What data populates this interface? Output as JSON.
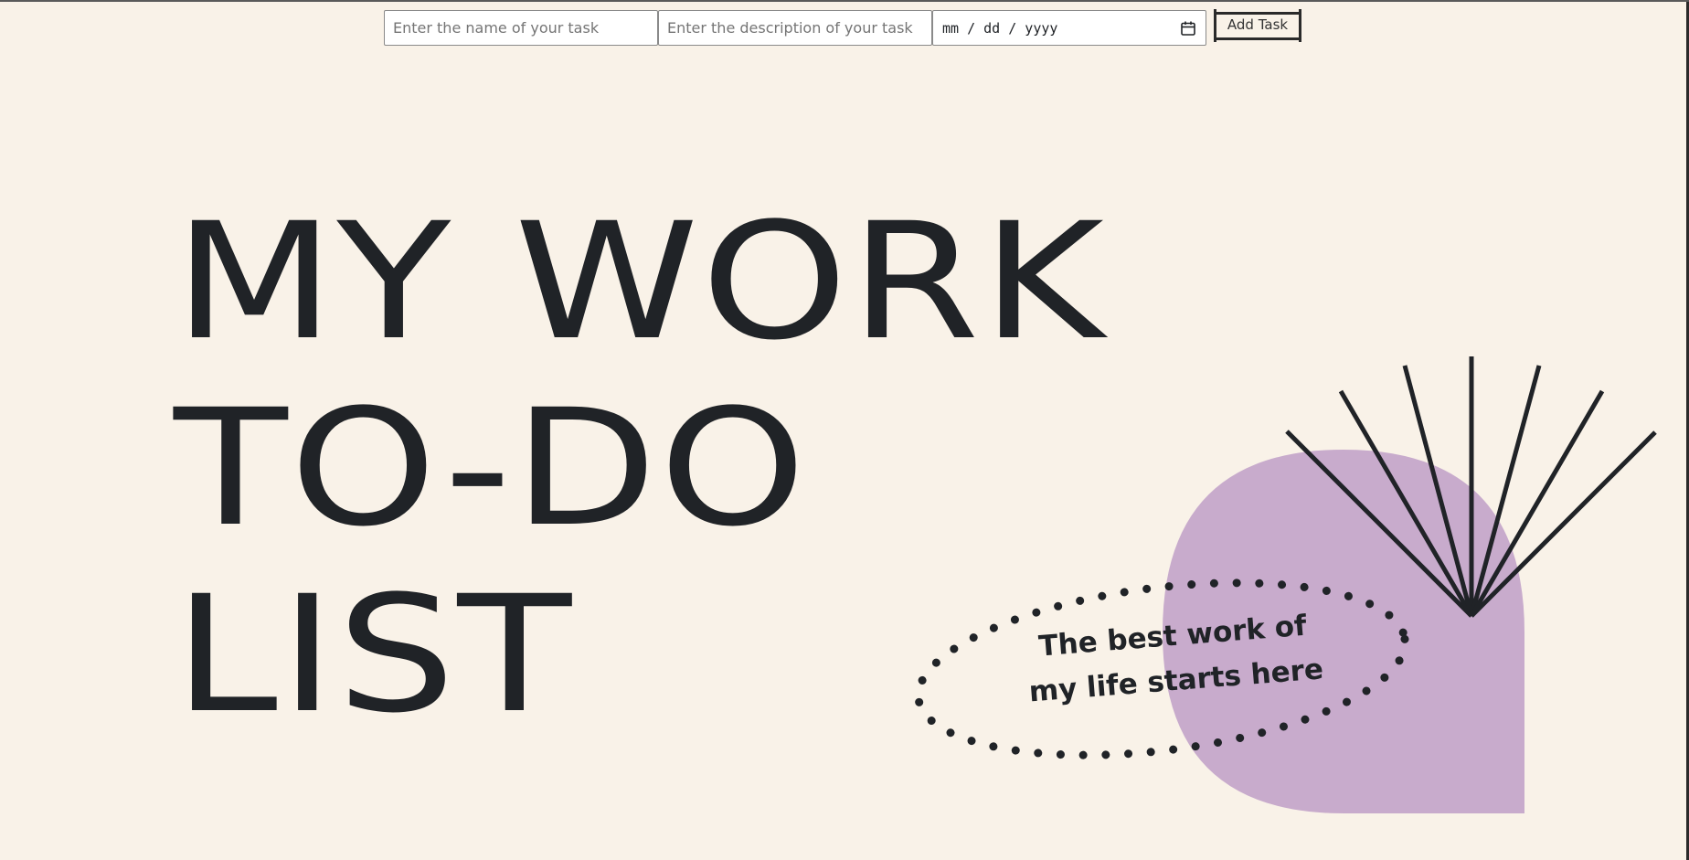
{
  "form": {
    "name_placeholder": "Enter the name of your task",
    "description_placeholder": "Enter the description of your task",
    "date_placeholder": "mm / dd / yyyy",
    "add_button_label": "Add Task"
  },
  "hero": {
    "title_line_1": "MY WORK",
    "title_line_2": "TO-DO",
    "title_line_3": "LIST",
    "tagline_line_1": "The best work of",
    "tagline_line_2": "my life starts here"
  },
  "colors": {
    "background": "#f9f2e8",
    "text": "#202327",
    "blob": "#c8abcc"
  },
  "icons": {
    "date_picker": "calendar-icon"
  }
}
